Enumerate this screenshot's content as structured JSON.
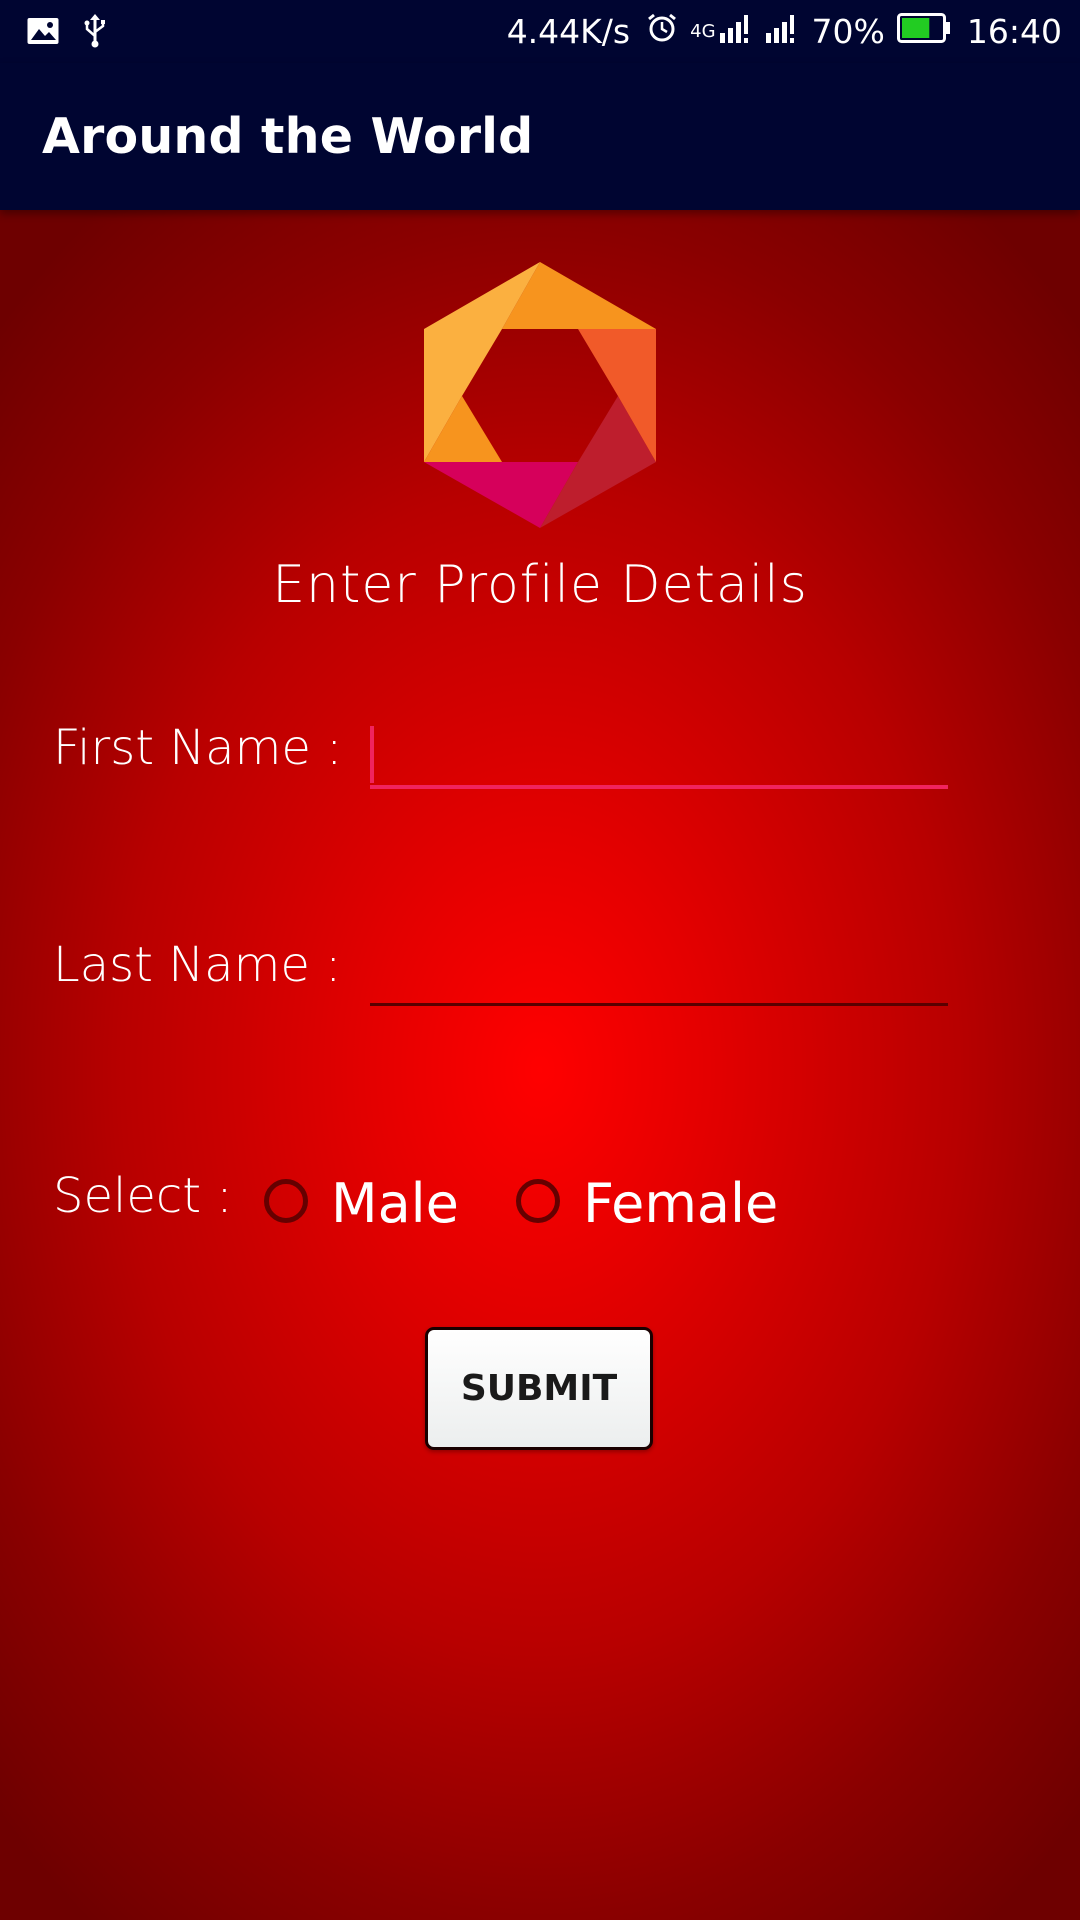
{
  "status_bar": {
    "net_speed": "4.44K/s",
    "network_type": "4G",
    "battery_percent": "70%",
    "battery_level": 0.7,
    "time": "16:40",
    "icons": [
      "image-icon",
      "usb-icon",
      "alarm-icon",
      "signal-icon",
      "signal-icon",
      "battery-icon"
    ]
  },
  "app_bar": {
    "title": "Around the World"
  },
  "form": {
    "title": "Enter Profile Details",
    "first_name_label": "First Name :",
    "first_name_value": "",
    "last_name_label": "Last Name :",
    "last_name_value": "",
    "select_label": "Select :",
    "gender_options": [
      "Male",
      "Female"
    ],
    "submit_label": "SUBMIT"
  },
  "colors": {
    "app_bar": "#000531",
    "background_center": "#ff0000",
    "background_edge": "#6e0000",
    "accent": "#f0245e",
    "logo_orange": "#f7941e",
    "logo_light_orange": "#fbb040",
    "logo_red_orange": "#f15a29",
    "logo_dark_red": "#be1e2d",
    "logo_magenta": "#d6005b"
  }
}
